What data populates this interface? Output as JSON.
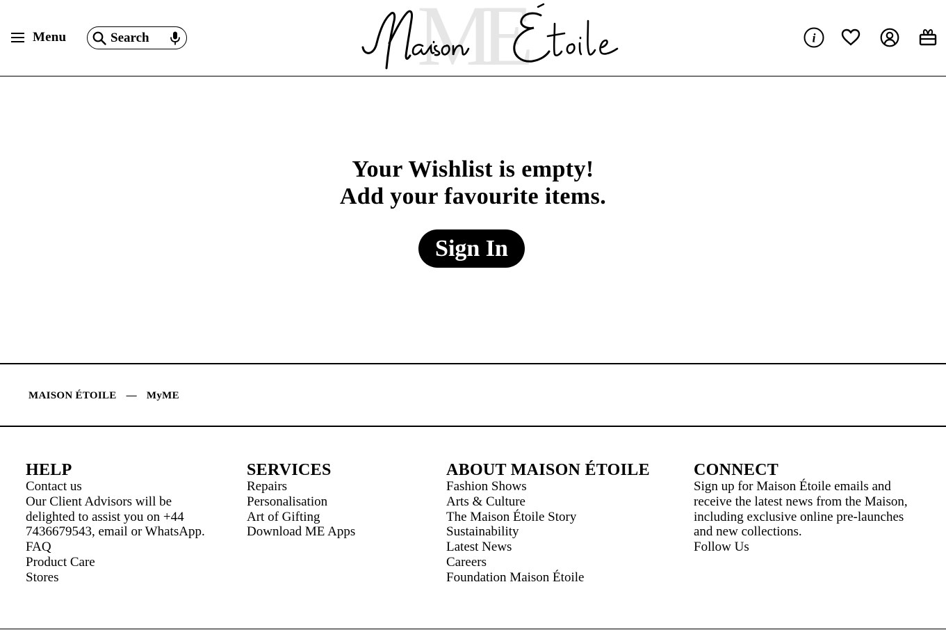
{
  "header": {
    "menu_label": "Menu",
    "search_placeholder": "Search",
    "logo_script_text": "Maison Étoile",
    "logo_monogram": "ME",
    "icons": [
      "info-icon",
      "heart-icon",
      "account-icon",
      "bag-icon"
    ]
  },
  "main": {
    "line1": "Your Wishlist is empty!",
    "line2": "Add your favourite items.",
    "signin_label": "Sign In"
  },
  "breadcrumb": {
    "home": "MAISON ÉTOILE",
    "separator": "—",
    "current": "MyME"
  },
  "footer": {
    "help": {
      "title": "HELP",
      "contact": "Contact us",
      "advisors_line1": "Our Client Advisors will be",
      "advisors_line2": "delighted to assist you on +44",
      "advisors_line3": "7436679543, email or WhatsApp.",
      "faq": "FAQ",
      "product_care": "Product Care",
      "stores": "Stores"
    },
    "services": {
      "title": "SERVICES",
      "links": [
        "Repairs",
        "Personalisation",
        "Art of Gifting",
        "Download ME Apps"
      ]
    },
    "about": {
      "title": "ABOUT MAISON ÉTOILE",
      "links": [
        "Fashion Shows",
        "Arts & Culture",
        "The Maison Étoile Story",
        "Sustainability",
        "Latest News",
        "Careers",
        "Foundation Maison Étoile"
      ]
    },
    "connect": {
      "title": "CONNECT",
      "text_line1": "Sign up for Maison Étoile emails and",
      "text_line2": "receive the latest news from the Maison,",
      "text_line3": "including exclusive online pre-launches",
      "text_line4": "and new collections.",
      "follow": "Follow Us"
    }
  }
}
